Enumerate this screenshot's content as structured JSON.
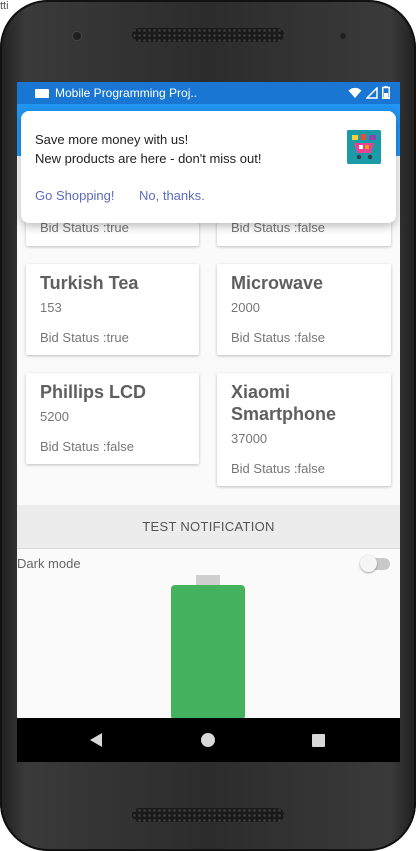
{
  "window": {
    "top_left_text": "tti"
  },
  "statusbar": {
    "title": "Mobile Programming Proj.."
  },
  "notification": {
    "line1": "Save more money with us!",
    "line2": "New products are here - don't miss out!",
    "action_primary": "Go Shopping!",
    "action_secondary": "No, thanks."
  },
  "products": [
    {
      "status": "Bid Status :true"
    },
    {
      "status": "Bid Status :false"
    },
    {
      "name": "Turkish Tea",
      "price": "153",
      "status": "Bid Status :true"
    },
    {
      "name": "Microwave",
      "price": "2000",
      "status": "Bid Status :false"
    },
    {
      "name": "Phillips LCD",
      "price": "5200",
      "status": "Bid Status :false"
    },
    {
      "name": "Xiaomi Smartphone",
      "price": "37000",
      "status": "Bid Status :false"
    }
  ],
  "actions": {
    "test_notification": "TEST NOTIFICATION"
  },
  "settings": {
    "dark_mode_label": "Dark mode",
    "dark_mode_on": false
  },
  "colors": {
    "statusbar": "#1976d2",
    "appbar": "#2196f3",
    "battery": "#43b15d",
    "link": "#5c6bc0"
  },
  "icons": [
    "wifi-icon",
    "signal-icon",
    "battery-status-icon",
    "back-icon",
    "home-icon",
    "recents-icon"
  ]
}
